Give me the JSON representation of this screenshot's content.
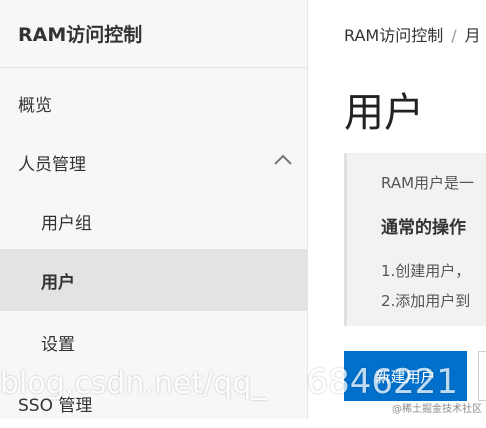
{
  "sidebar": {
    "title": "RAM访问控制",
    "items": [
      {
        "label": "概览"
      },
      {
        "label": "人员管理",
        "expanded": true
      },
      {
        "label": "用户组"
      },
      {
        "label": "用户",
        "active": true
      },
      {
        "label": "设置"
      },
      {
        "label": "SSO 管理"
      }
    ]
  },
  "main": {
    "breadcrumb": [
      "RAM访问控制",
      "/",
      "月"
    ],
    "title": "用户",
    "info": {
      "intro": "RAM用户是一",
      "heading": "通常的操作",
      "step1": "1.创建用户，",
      "step2": "2.添加用户到"
    },
    "create_button": "新建用户"
  },
  "watermarks": {
    "url": "blog.csdn.net/qq_",
    "number": "6846221",
    "corner": "@稀土掘金技术社区"
  },
  "colors": {
    "primary": "#0070cc",
    "sidebar_bg": "#f7f7f7",
    "active_bg": "#e3e3e3"
  }
}
